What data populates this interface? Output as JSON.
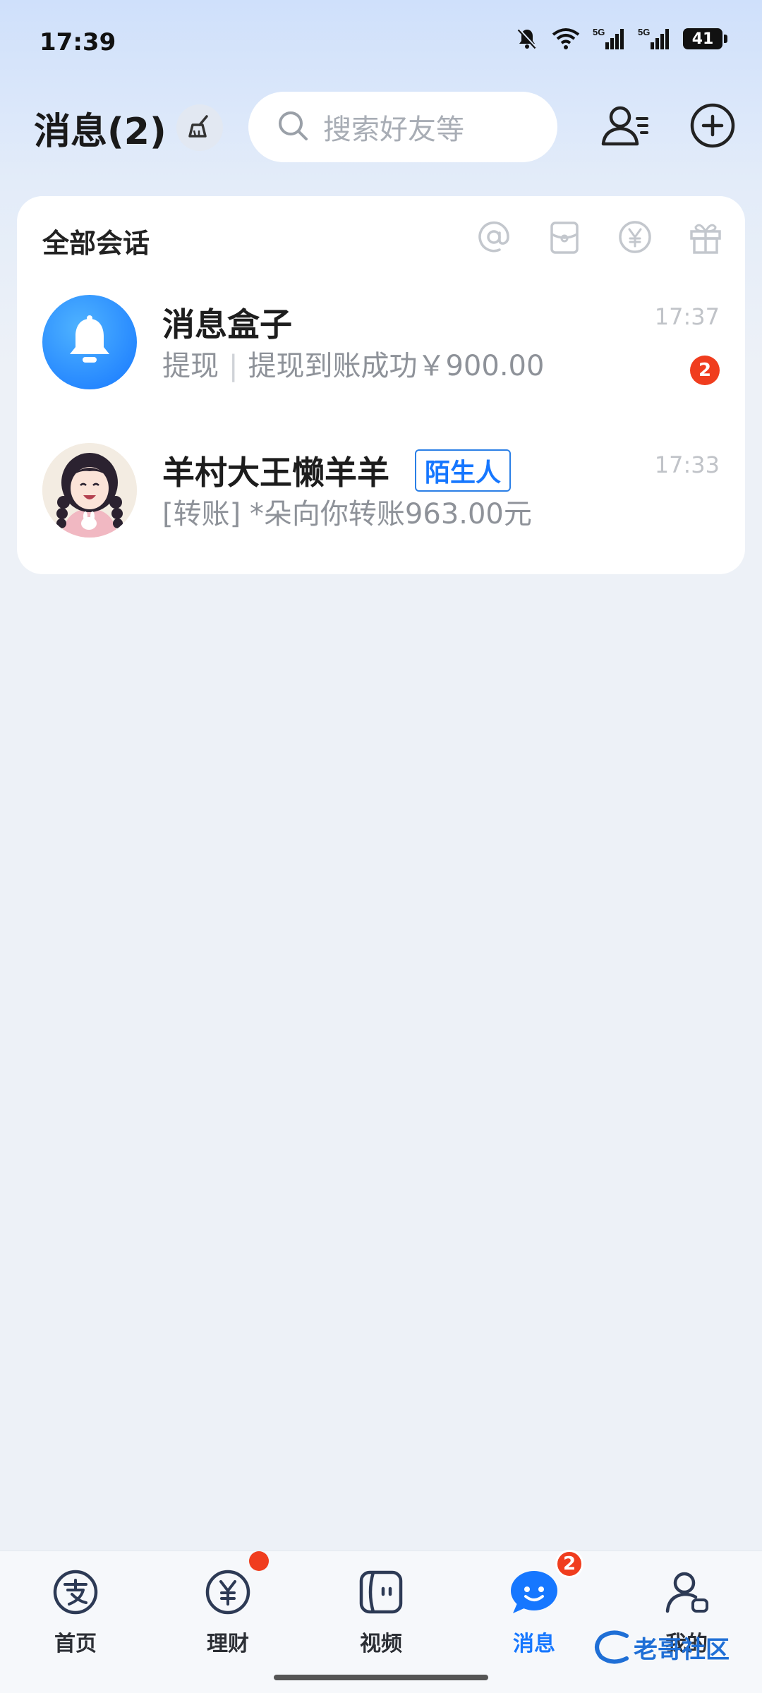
{
  "status_bar": {
    "time": "17:39",
    "battery": "41",
    "signal_1_label": "5G",
    "signal_2_label": "5G",
    "icons": [
      "mute-bell-icon",
      "wifi-icon",
      "signal-5g-icon",
      "signal-5g-icon",
      "battery-icon"
    ]
  },
  "header": {
    "title": "消息(2)",
    "search_placeholder": "搜索好友等",
    "icons": [
      "broom-clean-icon",
      "search-icon",
      "contacts-icon",
      "plus-circle-icon"
    ]
  },
  "card": {
    "title": "全部会话",
    "filter_icons": [
      "at-mention-icon",
      "red-packet-icon",
      "yuan-icon",
      "gift-icon"
    ],
    "conversations": [
      {
        "name": "消息盒子",
        "preview_tag": "提现",
        "preview_separator": "|",
        "preview_text": "提现到账成功￥900.00",
        "time": "17:37",
        "unread": "2",
        "avatar": "bell-icon",
        "avatar_color": "#1a8cff"
      },
      {
        "name": "羊村大王懒羊羊",
        "tag": "陌生人",
        "preview_text": "[转账] *朵向你转账963.00元",
        "time": "17:33",
        "avatar": "girl-illustration-avatar"
      }
    ]
  },
  "bottom_nav": {
    "items": [
      {
        "label": "首页",
        "icon": "alipay-home-icon",
        "active": false
      },
      {
        "label": "理财",
        "icon": "yuan-circle-icon",
        "active": false,
        "dot": true
      },
      {
        "label": "视频",
        "icon": "video-icon",
        "active": false
      },
      {
        "label": "消息",
        "icon": "message-bubble-icon",
        "active": true,
        "badge": "2"
      },
      {
        "label": "我的",
        "icon": "profile-icon",
        "active": false
      }
    ]
  },
  "watermark": {
    "text": "老哥社区"
  },
  "colors": {
    "accent": "#1677ff",
    "badge": "#f03d1e"
  }
}
